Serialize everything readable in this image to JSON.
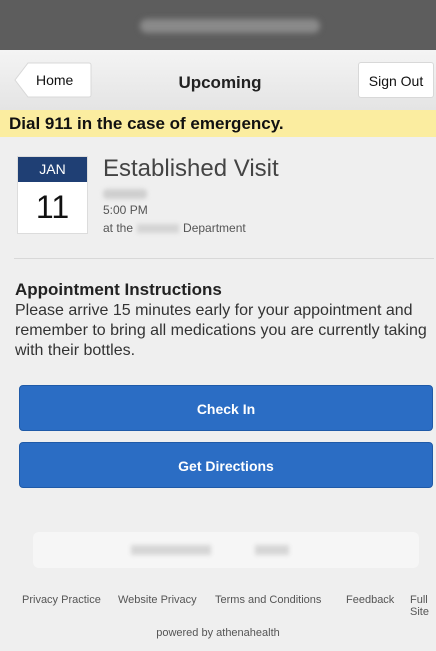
{
  "header": {
    "back_label": "Home",
    "title": "Upcoming",
    "signout_label": "Sign Out"
  },
  "alert": {
    "text": "Dial 911 in the case of emergency."
  },
  "appointment": {
    "month": "JAN",
    "day": "11",
    "type": "Established Visit",
    "time": "5:00 PM",
    "dept_prefix": "at the",
    "dept_suffix": "Department"
  },
  "instructions": {
    "title": "Appointment Instructions",
    "text": "Please arrive 15 minutes early for your appointment and remember to bring all medications you are currently taking with their bottles."
  },
  "actions": {
    "check_in": "Check In",
    "directions": "Get Directions"
  },
  "footer": {
    "links": [
      "Privacy Practice",
      "Website Privacy",
      "Terms and Conditions",
      "Feedback",
      "Full Site"
    ],
    "powered": "powered by athenahealth"
  },
  "colors": {
    "topbar": "#5d5d5d",
    "alert_bg": "#fbeda0",
    "calendar_month": "#1f3f74",
    "button": "#2b6dc4"
  }
}
